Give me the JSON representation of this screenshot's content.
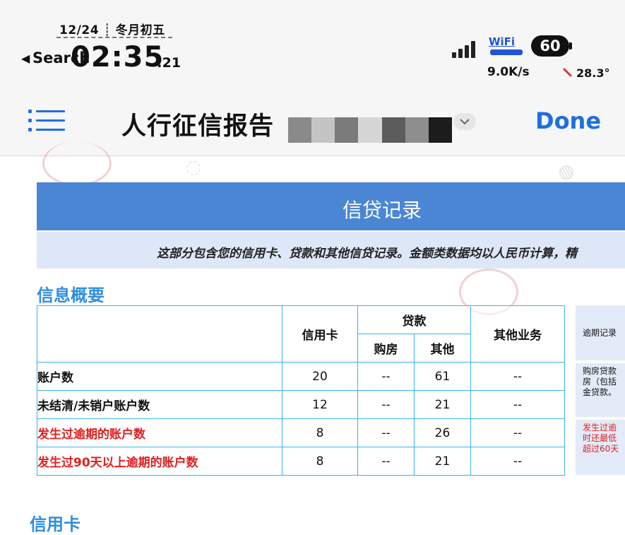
{
  "status_bar": {
    "date": "12/24 ┊ 冬月初五",
    "back_label": "Search",
    "time_main": "02:35",
    "time_seconds": ":21",
    "wifi_label": "WiFi",
    "battery_level": "60",
    "network_speed": "9.0K/s",
    "temperature": "28.3°"
  },
  "nav": {
    "menu_icon": "list-icon",
    "title": "人行征信报告",
    "done_label": "Done",
    "accent_color": "#1f6fe0"
  },
  "credit_record": {
    "banner_title": "信贷记录",
    "notice": "这部分包含您的信用卡、贷款和其他信贷记录。金额类数据均以人民币计算，精"
  },
  "summary": {
    "section_title": "信息概要",
    "headers": {
      "credit_card": "信用卡",
      "loan": "贷款",
      "housing": "购房",
      "other": "其他",
      "other_business": "其他业务"
    },
    "rows": [
      {
        "label": "账户数",
        "credit_card": "20",
        "housing": "--",
        "other": "61",
        "other_business": "--",
        "highlight": false
      },
      {
        "label": "未结清/未销户账户数",
        "credit_card": "12",
        "housing": "--",
        "other": "21",
        "other_business": "--",
        "highlight": false
      },
      {
        "label": "发生过逾期的账户数",
        "credit_card": "8",
        "housing": "--",
        "other": "26",
        "other_business": "--",
        "highlight": true
      },
      {
        "label": "发生过90天以上逾期的账户数",
        "credit_card": "8",
        "housing": "--",
        "other": "21",
        "other_business": "--",
        "highlight": true
      }
    ],
    "highlight_color": "#e02020"
  },
  "side_notes": {
    "note1": "逾期记录",
    "note2": "购房贷款 房（包括 金贷款。",
    "note3": "发生过逾 时还最低 超过60天"
  },
  "next_section": {
    "title": "信用卡"
  }
}
